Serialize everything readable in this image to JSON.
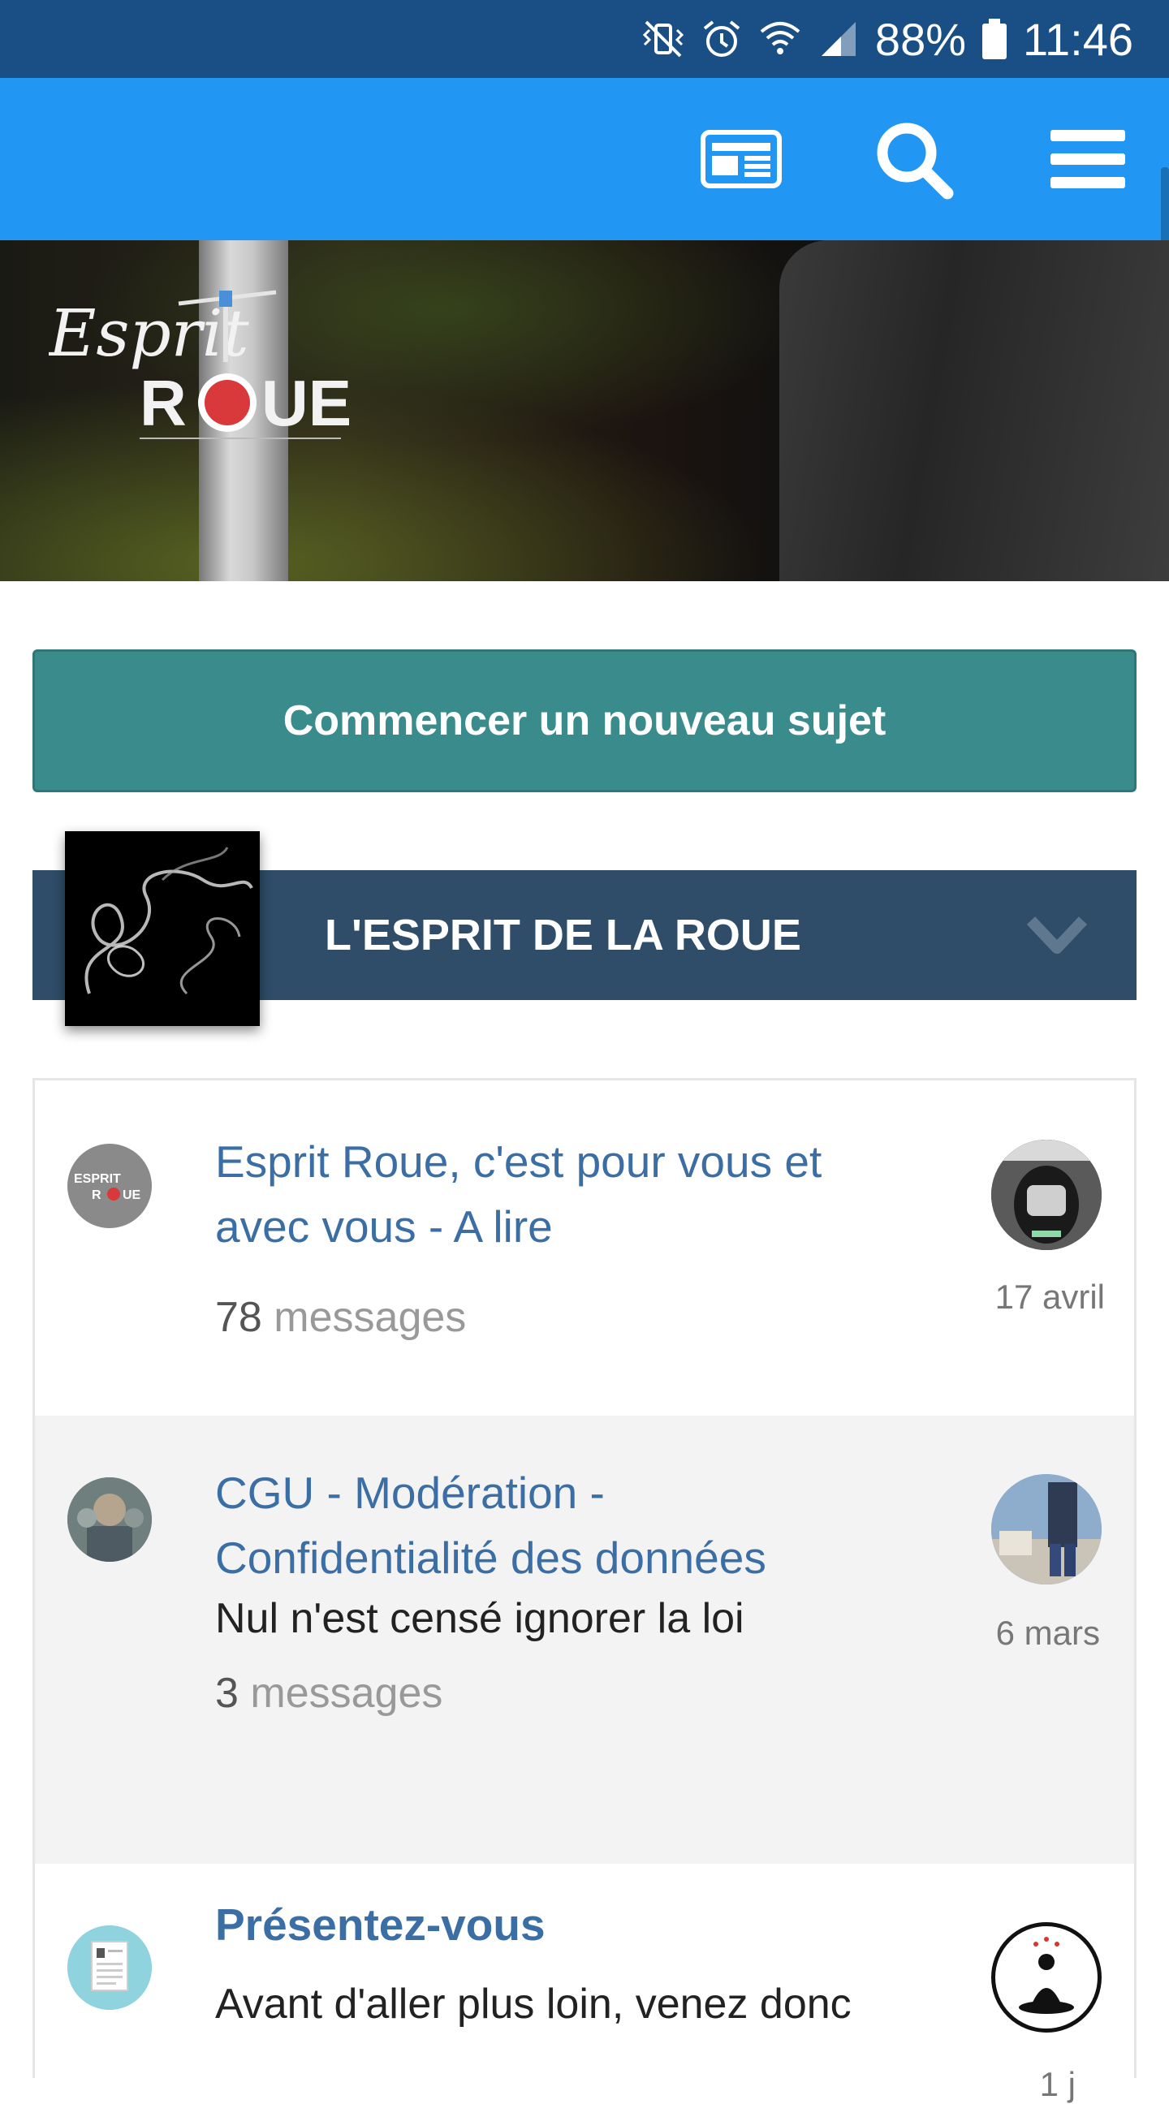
{
  "status_bar": {
    "battery": "88%",
    "time": "11:46",
    "icons": [
      "vibrate-icon",
      "alarm-icon",
      "wifi-icon",
      "signal-icon",
      "battery-icon"
    ]
  },
  "app_bar": {
    "icons": [
      "news-icon",
      "search-icon",
      "menu-icon"
    ],
    "color": "#2196f3"
  },
  "hero": {
    "logo_text_top": "Esprit",
    "logo_text_bottom_left": "R",
    "logo_text_bottom_right": "UE"
  },
  "new_topic_button": {
    "label": "Commencer un nouveau sujet",
    "color": "#3a8b8b"
  },
  "category": {
    "title": "L'ESPRIT DE LA ROUE",
    "header_color": "#2f4c68"
  },
  "topics": [
    {
      "title": "Esprit Roue, c'est pour vous et avec vous - A lire",
      "title_line1": "Esprit Roue, c'est pour vous et",
      "title_line2": "avec vous - A lire",
      "description": "",
      "count_number": "78",
      "count_label": "messages",
      "date": "17 avril",
      "author_avatar": "esprit-roue-logo",
      "last_avatar": "wheel-photo"
    },
    {
      "title": "CGU - Modération - Confidentialité des données",
      "title_line1": "CGU - Modération -",
      "title_line2": "Confidentialité des données",
      "description": "Nul n'est censé ignorer la loi",
      "count_number": "3",
      "count_label": "messages",
      "date": "6 mars",
      "author_avatar": "group-photo",
      "last_avatar": "rider-photo"
    },
    {
      "title": "Présentez-vous",
      "description": "Avant d'aller plus loin, venez donc",
      "date": "1 j",
      "author_avatar": "document-icon",
      "last_avatar": "meditating-figure"
    }
  ]
}
